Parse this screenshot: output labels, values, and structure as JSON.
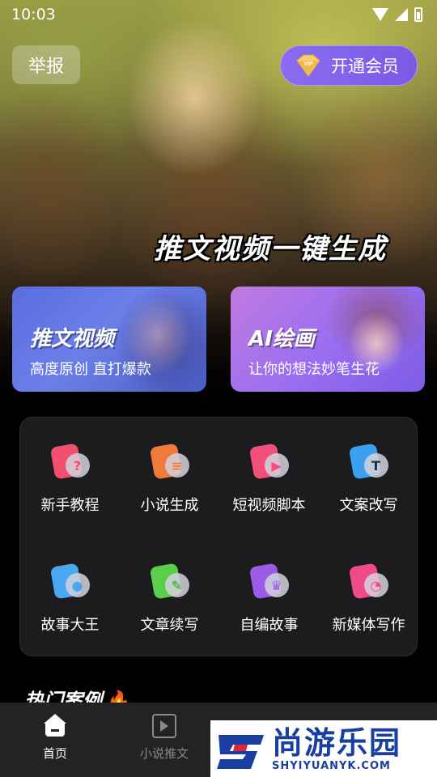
{
  "status_bar": {
    "time": "10:03"
  },
  "header": {
    "report_label": "举报",
    "vip_badge": "VIP",
    "vip_label": "开通会员"
  },
  "hero": {
    "slogan": "推文视频一键生成"
  },
  "feature_cards": [
    {
      "title": "推文视频",
      "subtitle": "高度原创 直打爆款"
    },
    {
      "title": "AI绘画",
      "subtitle": "让你的想法妙笔生花"
    }
  ],
  "tools": [
    {
      "label": "新手教程",
      "icon": "question-icon",
      "color": "#f0506e",
      "glyph": "?"
    },
    {
      "label": "小说生成",
      "icon": "document-icon",
      "color": "#f07a3c",
      "glyph": "≡"
    },
    {
      "label": "短视频脚本",
      "icon": "film-icon",
      "color": "#f0507a",
      "glyph": "▶"
    },
    {
      "label": "文案改写",
      "icon": "text-icon",
      "color": "#3ca0f0",
      "glyph": "T"
    },
    {
      "label": "故事大王",
      "icon": "bulb-icon",
      "color": "#4aa8f0",
      "glyph": "●"
    },
    {
      "label": "文章续写",
      "icon": "pen-icon",
      "color": "#5ccf4a",
      "glyph": "✎"
    },
    {
      "label": "自编故事",
      "icon": "crown-icon",
      "color": "#9a5ce6",
      "glyph": "♛"
    },
    {
      "label": "新媒体写作",
      "icon": "chat-icon",
      "color": "#f04a8a",
      "glyph": "◔"
    }
  ],
  "hot_section": {
    "title": "热门案例"
  },
  "bottom_nav": [
    {
      "label": "首页",
      "icon": "home-icon",
      "active": true
    },
    {
      "label": "小说推文",
      "icon": "video-icon",
      "active": false
    }
  ],
  "watermark": {
    "cn": "尚游乐园",
    "en": "SHYIYUANYK.COM"
  }
}
